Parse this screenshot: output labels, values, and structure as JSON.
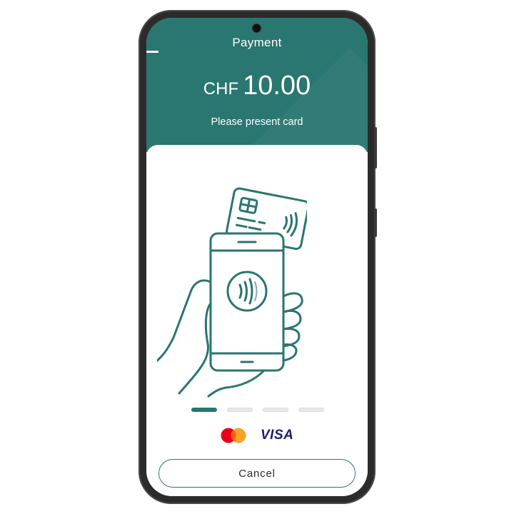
{
  "header": {
    "title": "Payment",
    "currency": "CHF",
    "amount": "10.00",
    "status": "Please present card"
  },
  "illustration": {
    "icon": "tap-card-on-phone-icon"
  },
  "pager": {
    "count": 4,
    "active_index": 0
  },
  "brands": [
    {
      "name": "mastercard-logo"
    },
    {
      "name": "VISA"
    }
  ],
  "actions": {
    "cancel_label": "Cancel"
  },
  "colors": {
    "accent": "#2a7670",
    "illustration_stroke": "#2a7670",
    "mastercard_red": "#eb001b",
    "mastercard_orange": "#f79e1b",
    "visa_blue": "#1a1f71"
  }
}
